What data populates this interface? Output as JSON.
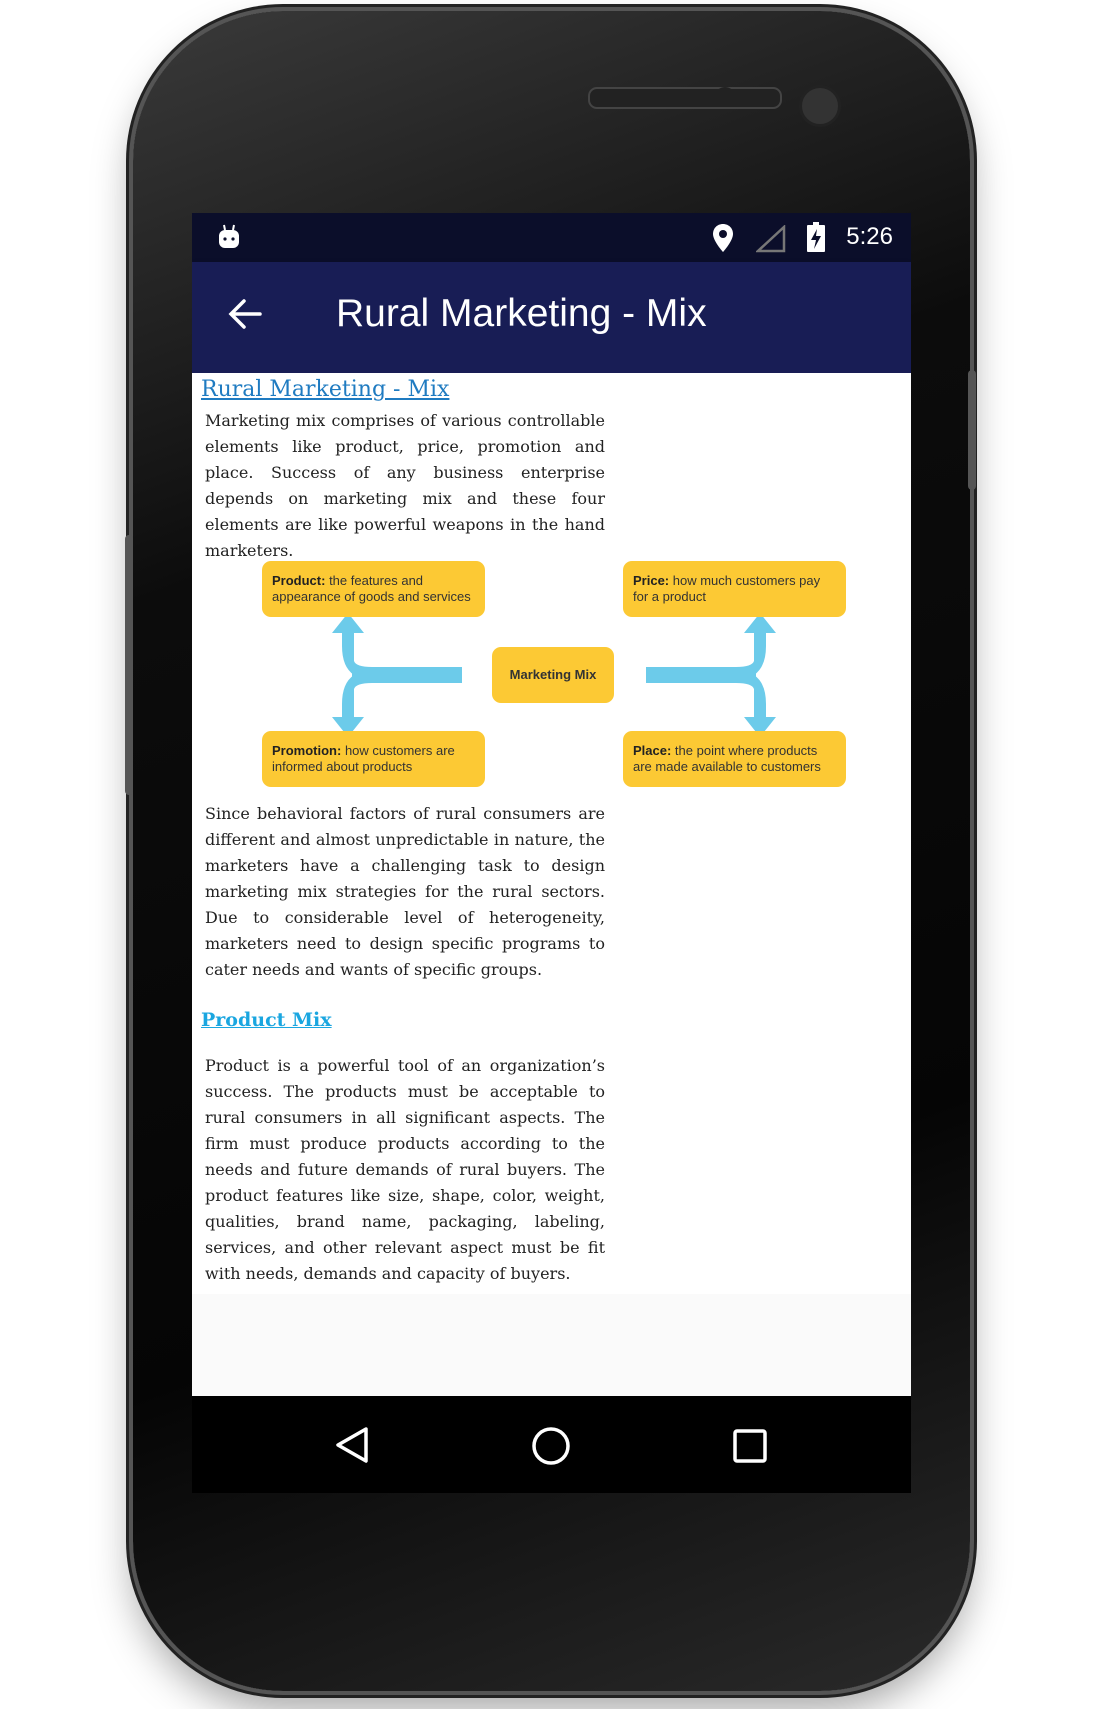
{
  "status_bar": {
    "time": "5:26",
    "icons": [
      "android-debug-icon",
      "location-icon",
      "signal-icon",
      "battery-charging-icon"
    ]
  },
  "app_bar": {
    "title": "Rural Marketing - Mix",
    "back_icon": "arrow-left-icon"
  },
  "article": {
    "heading": "Rural Marketing - Mix",
    "intro": "Marketing mix comprises of various controllable elements like product, price, promotion and place. Success of any business enterprise depends on marketing mix and these four elements are like powerful weapons in the hand marketers.",
    "diagram": {
      "center": "Marketing Mix",
      "product": {
        "term": "Product:",
        "desc": " the features and appearance of goods and services"
      },
      "price": {
        "term": "Price:",
        "desc": " how much customers pay for a product"
      },
      "promotion": {
        "term": "Promotion:",
        "desc": " how customers are informed about products"
      },
      "place": {
        "term": "Place:",
        "desc": " the point where products are made available to customers"
      },
      "box_color": "#fcc934",
      "arrow_color": "#6ccbea"
    },
    "para2": "Since behavioral factors of rural consumers are different and almost unpredictable in nature, the marketers have a challenging task to design marketing mix strategies for the rural sectors. Due to considerable level of heterogeneity, marketers need to design specific programs to cater needs and wants of specific groups.",
    "section_heading": "Product Mix",
    "para3": "Product is a powerful tool of an organization’s success. The products must be acceptable to rural consumers in all significant aspects. The firm must produce products according to the needs and future demands of rural buyers. The product features like size, shape, color, weight, qualities, brand name, packaging, labeling, services, and other relevant aspect must be fit with needs, demands and capacity of buyers."
  },
  "nav_bar": {
    "back": "nav-back-icon",
    "home": "nav-home-icon",
    "recents": "nav-recents-icon"
  },
  "colors": {
    "app_bar": "#181d55",
    "link": "#1f7bc1",
    "section_link": "#1aa6e0"
  }
}
